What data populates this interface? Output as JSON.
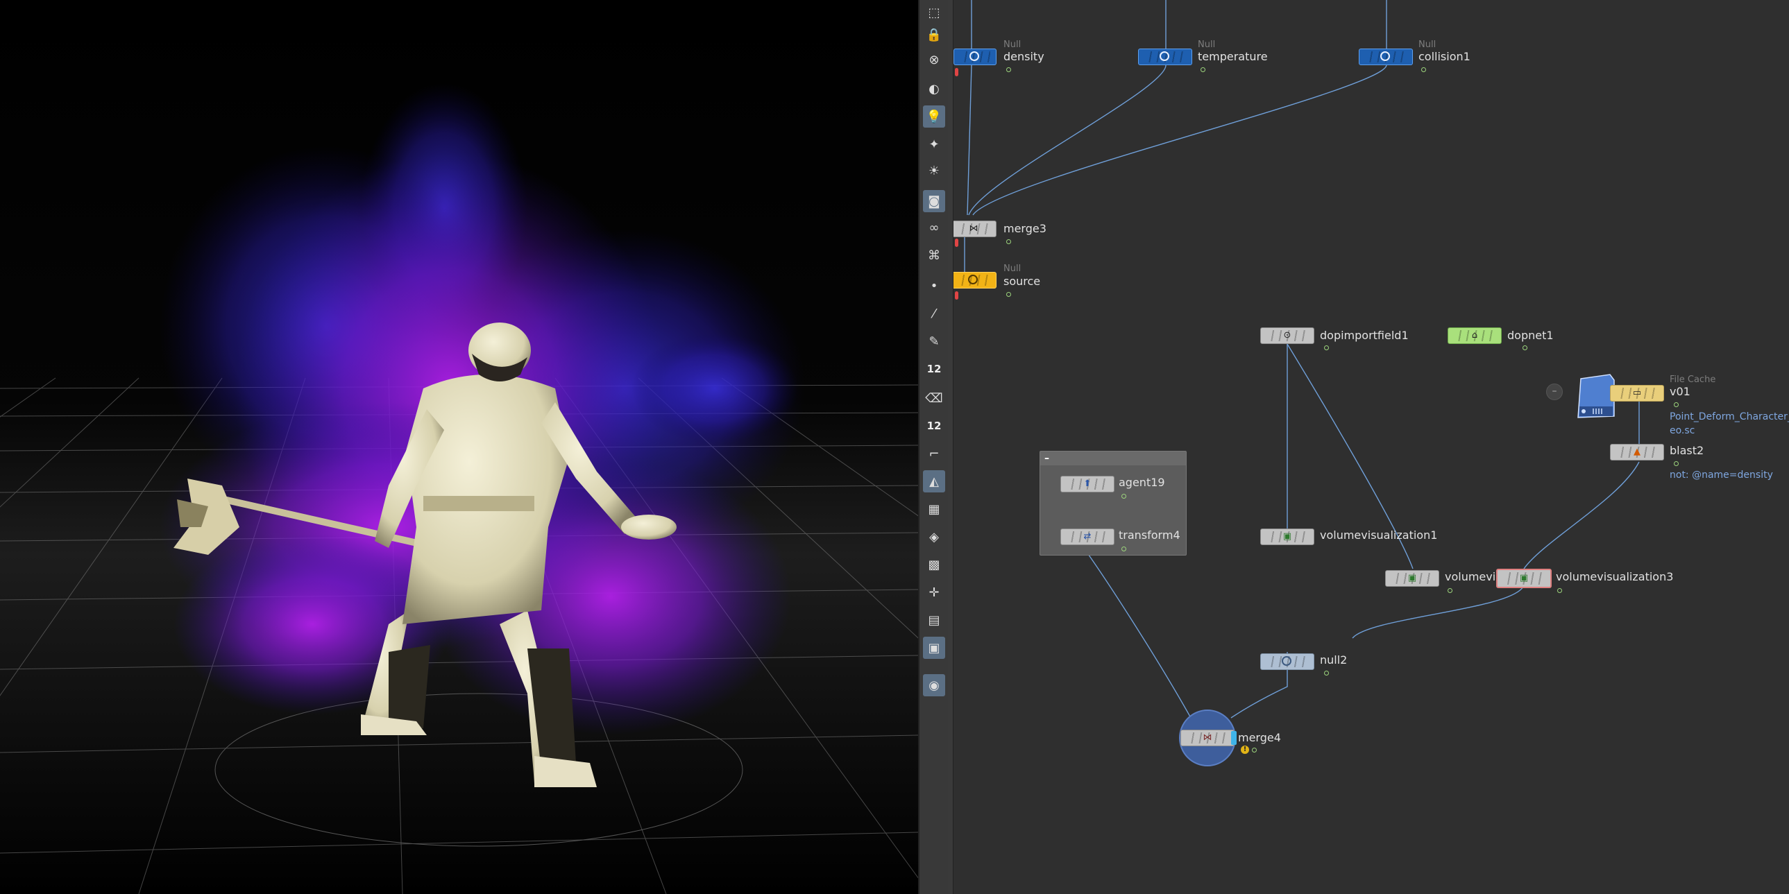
{
  "toolbar": {
    "items": [
      {
        "name": "select-icon",
        "glyph": "⬚",
        "active": false
      },
      {
        "name": "lock-icon",
        "glyph": "🔒",
        "active": false
      },
      {
        "name": "close-icon",
        "glyph": "⊗",
        "active": false
      },
      {
        "name": "headlight-icon",
        "glyph": "◐",
        "active": false
      },
      {
        "name": "light-bulb-icon",
        "glyph": "💡",
        "active": true
      },
      {
        "name": "point-light-icon",
        "glyph": "✦",
        "active": false
      },
      {
        "name": "spot-light-icon",
        "glyph": "☀",
        "active": false
      },
      {
        "name": "camera-icon",
        "glyph": "◙",
        "active": true
      },
      {
        "name": "glasses-icon",
        "glyph": "∞",
        "active": false
      },
      {
        "name": "camera-view-icon",
        "glyph": "⌘",
        "active": false
      },
      {
        "name": "point-icon",
        "glyph": "•",
        "active": false
      },
      {
        "name": "paint-brush-icon",
        "glyph": "⁄",
        "active": false
      },
      {
        "name": "pen-icon",
        "glyph": "✎",
        "active": false
      },
      {
        "name": "point-size-icon",
        "glyph": "12",
        "active": false
      },
      {
        "name": "eraser-icon",
        "glyph": "⌫",
        "active": false
      },
      {
        "name": "text-size-icon",
        "glyph": "12",
        "active": false
      },
      {
        "name": "curve-icon",
        "glyph": "⌐",
        "active": false
      },
      {
        "name": "shading-icon",
        "glyph": "◭",
        "active": true
      },
      {
        "name": "checker-icon",
        "glyph": "▦",
        "active": false
      },
      {
        "name": "diamond-icon",
        "glyph": "◈",
        "active": false
      },
      {
        "name": "map-icon",
        "glyph": "▩",
        "active": false
      },
      {
        "name": "axes-icon",
        "glyph": "✛",
        "active": false
      },
      {
        "name": "layer-icon",
        "glyph": "▤",
        "active": false
      },
      {
        "name": "background-image-icon",
        "glyph": "▣",
        "active": true
      },
      {
        "name": "marker-icon",
        "glyph": "◉",
        "active": true
      }
    ]
  },
  "network": {
    "nodes": {
      "density": {
        "label": "density",
        "type": "Null"
      },
      "temperature": {
        "label": "temperature",
        "type": "Null"
      },
      "collision1": {
        "label": "collision1",
        "type": "Null"
      },
      "merge3": {
        "label": "merge3"
      },
      "source": {
        "label": "source",
        "type": "Null"
      },
      "dopimportfield1": {
        "label": "dopimportfield1"
      },
      "dopnet1": {
        "label": "dopnet1"
      },
      "filecache": {
        "type": "File Cache",
        "label": "v01",
        "path": "Point_Deform_Character_v",
        "path2": "eo.sc"
      },
      "blast2": {
        "label": "blast2",
        "group": "not: @name=density"
      },
      "agent19": {
        "label": "agent19"
      },
      "transform4": {
        "label": "transform4"
      },
      "volumevisualization1": {
        "label": "volumevisualization1"
      },
      "volumevis": {
        "label": "volumevis"
      },
      "volumevisualization3": {
        "label": "volumevisualization3"
      },
      "null2": {
        "label": "null2"
      },
      "merge4": {
        "label": "merge4"
      }
    }
  },
  "colors": {
    "smoke": "#7a1fd6",
    "null_blue": "#1e5fb0",
    "wire": "#6f9fd8",
    "yellow": "#f2b316"
  }
}
